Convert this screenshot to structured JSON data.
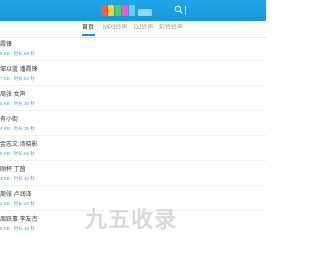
{
  "header": {
    "logo_text": "logo",
    "logo_colors": [
      "#ff5a3c",
      "#ffd22e",
      "#4bd65a",
      "#ff4fd8",
      "#6bd0ff"
    ]
  },
  "tabs": [
    {
      "label": "首页",
      "active": true
    },
    {
      "label": "MP3铃声",
      "active": false
    },
    {
      "label": "DJ铃声",
      "active": false
    },
    {
      "label": "彩铃铃声",
      "active": false
    }
  ],
  "items": [
    {
      "title": "霞锋",
      "meta": "5 KB  ·  时长:68 秒"
    },
    {
      "title": "邹以蓝 潘霞锋",
      "meta": "7 KB  ·  时长:53 秒"
    },
    {
      "title": "周张 女声",
      "meta": "5 KB  ·  时长:38 秒"
    },
    {
      "title": "有小街",
      "meta": "4 KB  ·  时长:35 秒"
    },
    {
      "title": "金志文 汤晓影",
      "meta": "5 KB  ·  时长:66 秒"
    },
    {
      "title": "刚杯 丁茵",
      "meta": "3 KB  ·  时长:48 秒"
    },
    {
      "title": "周张 卢润泽",
      "meta": "2 KB  ·  时长:20 秒"
    },
    {
      "title": "周跃事 李友杰",
      "meta": "5 KB  ·  时长:48 秒"
    }
  ],
  "watermark": "九五收录"
}
